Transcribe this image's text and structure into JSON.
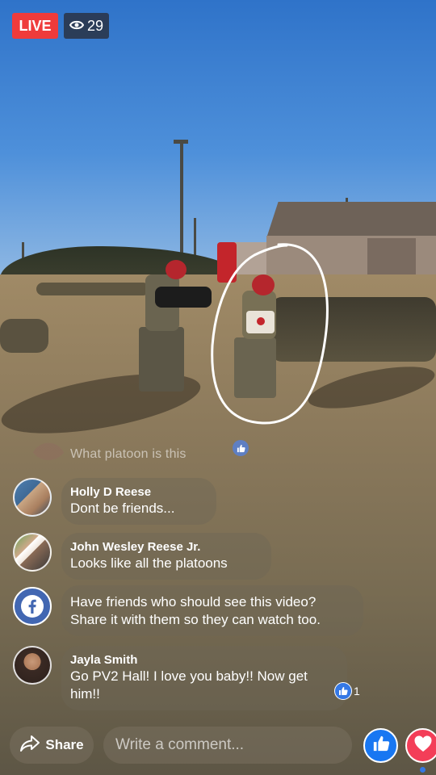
{
  "header": {
    "live_label": "LIVE",
    "viewer_count": "29",
    "viewer_icon": "eye-icon"
  },
  "faded_comment": {
    "text": "What platoon is this",
    "reaction_icon": "like-icon"
  },
  "comments": [
    {
      "name": "Holly D Reese",
      "text": "Dont be friends..."
    },
    {
      "name": "John Wesley Reese Jr.",
      "text": "Looks like all the platoons"
    },
    {
      "icon": "facebook-icon",
      "text_line1": "Have friends who should see this video?",
      "text_line2": "Share it with them so they can watch too."
    },
    {
      "name": "Jayla Smith",
      "text_line1": "Go PV2 Hall! I love you baby!! Now get",
      "text_line2": "him!!",
      "reaction_count": "1"
    }
  ],
  "footer": {
    "share_label": "Share",
    "comment_placeholder": "Write a comment...",
    "like_icon": "like-icon",
    "love_icon": "heart-icon"
  },
  "colors": {
    "live_red": "#ef3b3b",
    "facebook_blue": "#1877f2",
    "love_pink": "#f33e58"
  }
}
